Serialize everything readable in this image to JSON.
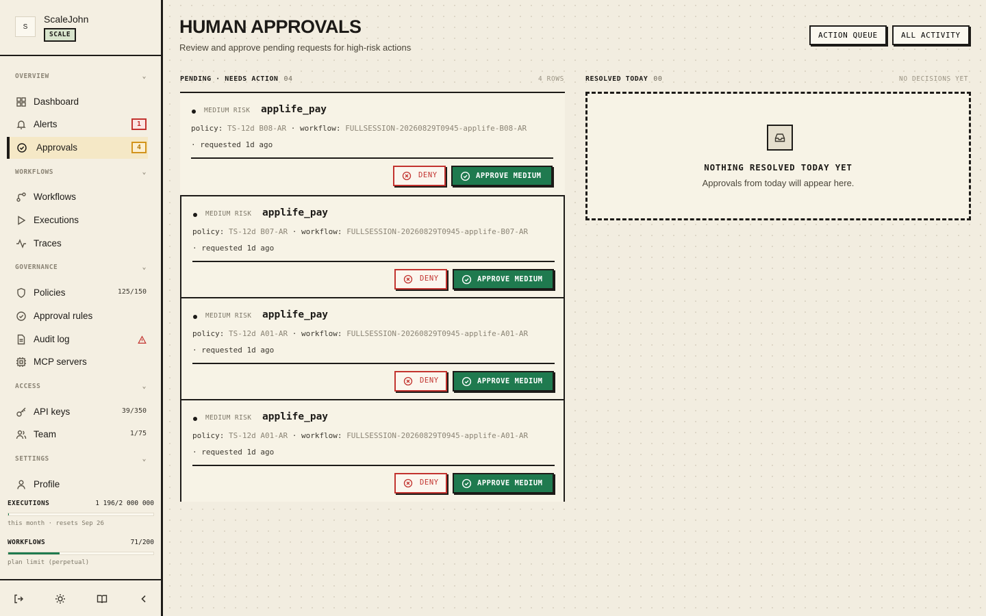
{
  "sidebar": {
    "avatar_letter": "S",
    "org_name": "ScaleJohn",
    "plan_badge": "SCALE",
    "sections": {
      "overview": "OVERVIEW",
      "workflows": "WORKFLOWS",
      "governance": "GOVERNANCE",
      "access": "ACCESS",
      "settings": "SETTINGS"
    },
    "items": {
      "dashboard": "Dashboard",
      "alerts": "Alerts",
      "alerts_badge": "1",
      "approvals": "Approvals",
      "approvals_badge": "4",
      "workflows": "Workflows",
      "executions": "Executions",
      "traces": "Traces",
      "policies": "Policies",
      "policies_meta": "125/150",
      "approval_rules": "Approval rules",
      "audit_log": "Audit log",
      "mcp_servers": "MCP servers",
      "api_keys": "API keys",
      "api_keys_meta": "39/350",
      "team": "Team",
      "team_meta": "1/75",
      "profile": "Profile"
    },
    "usage": {
      "executions_label": "EXECUTIONS",
      "executions_value": "1 196/2 000 000",
      "executions_fraction": 0.0006,
      "executions_note": "this month · resets Sep 26",
      "workflows_label": "WORKFLOWS",
      "workflows_value": "71/200",
      "workflows_fraction": 0.355,
      "workflows_note": "plan limit (perpetual)"
    },
    "colors": {
      "accent_green": "#1f7a4f",
      "alert_red": "#c2322e",
      "amber": "#d2931b"
    }
  },
  "header": {
    "title": "HUMAN APPROVALS",
    "subtitle": "Review and approve pending requests for high-risk actions",
    "action_queue": "ACTION QUEUE",
    "all_activity": "ALL ACTIVITY"
  },
  "pending": {
    "label": "PENDING · NEEDS ACTION",
    "count": "04",
    "rows_label": "4 ROWS",
    "cards": [
      {
        "risk": "MEDIUM RISK",
        "name": "applife_pay",
        "policy_label": "policy:",
        "policy": "TS-12d B08-AR",
        "workflow_label": "· workflow:",
        "workflow": "FULLSESSION-20260829T0945-applife-B08-AR",
        "requested": "·  requested 1d ago",
        "deny": "DENY",
        "approve": "APPROVE MEDIUM"
      },
      {
        "risk": "MEDIUM RISK",
        "name": "applife_pay",
        "policy_label": "policy:",
        "policy": "TS-12d B07-AR",
        "workflow_label": "· workflow:",
        "workflow": "FULLSESSION-20260829T0945-applife-B07-AR",
        "requested": "·  requested 1d ago",
        "deny": "DENY",
        "approve": "APPROVE MEDIUM"
      },
      {
        "risk": "MEDIUM RISK",
        "name": "applife_pay",
        "policy_label": "policy:",
        "policy": "TS-12d A01-AR",
        "workflow_label": "· workflow:",
        "workflow": "FULLSESSION-20260829T0945-applife-A01-AR",
        "requested": "·  requested 1d ago",
        "deny": "DENY",
        "approve": "APPROVE MEDIUM"
      },
      {
        "risk": "MEDIUM RISK",
        "name": "applife_pay",
        "policy_label": "policy:",
        "policy": "TS-12d A01-AR",
        "workflow_label": "· workflow:",
        "workflow": "FULLSESSION-20260829T0945-applife-A01-AR",
        "requested": "·  requested 1d ago",
        "deny": "DENY",
        "approve": "APPROVE MEDIUM"
      }
    ]
  },
  "resolved": {
    "label": "RESOLVED TODAY",
    "count": "00",
    "meta": "NO DECISIONS YET",
    "empty_title": "NOTHING RESOLVED TODAY YET",
    "empty_sub": "Approvals from today will appear here."
  }
}
